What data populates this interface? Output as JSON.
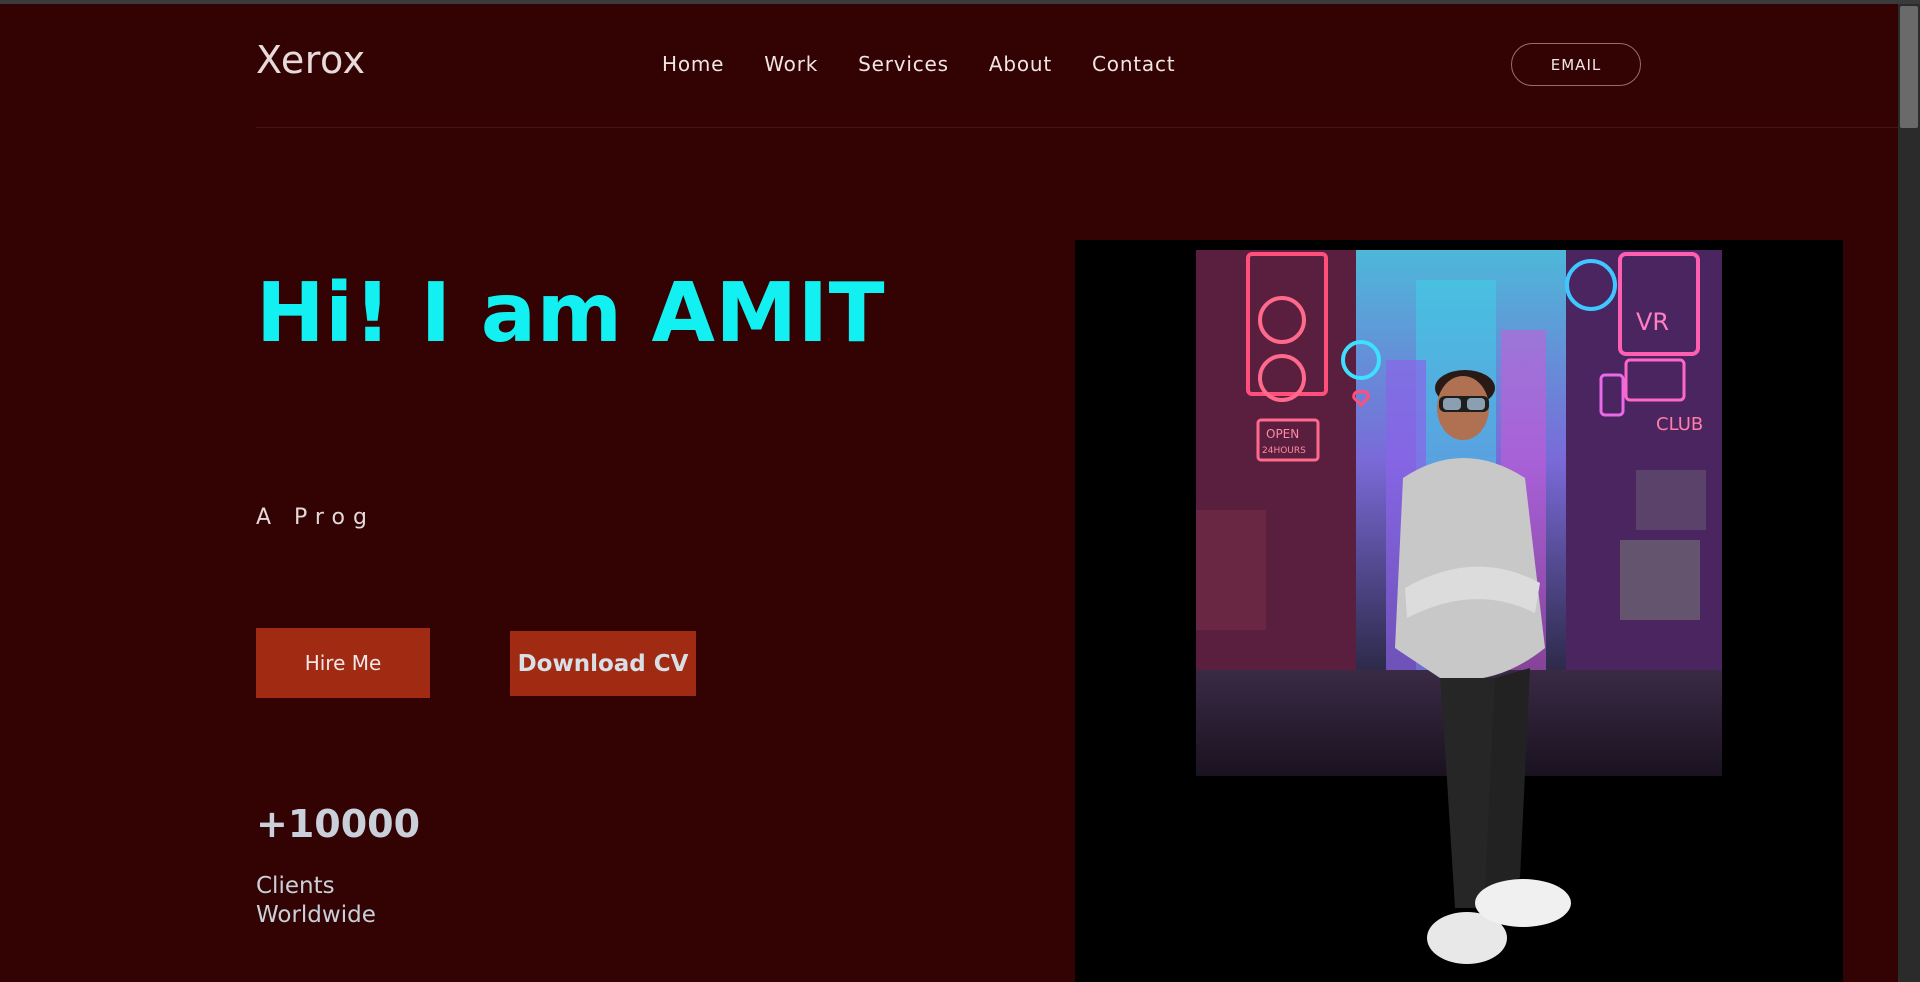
{
  "brand": {
    "logo_text": "Xerox"
  },
  "nav": {
    "items": [
      {
        "label": "Home"
      },
      {
        "label": "Work"
      },
      {
        "label": "Services"
      },
      {
        "label": "About"
      },
      {
        "label": "Contact"
      }
    ]
  },
  "header": {
    "email_button": "EMAIL"
  },
  "hero": {
    "title": "Hi! I am AMIT",
    "subtitle": "A Prog",
    "hire_button": "Hire Me",
    "cv_button": "Download CV"
  },
  "stats": {
    "value": "+10000",
    "label": "Clients Worldwide"
  },
  "portrait": {
    "sign_open": "OPEN",
    "sign_hours": "24HOURS",
    "sign_club": "CLUB",
    "sign_vr": "VR"
  },
  "colors": {
    "background": "#330303",
    "title_accent": "#12f0f2",
    "button": "#a02a12"
  }
}
